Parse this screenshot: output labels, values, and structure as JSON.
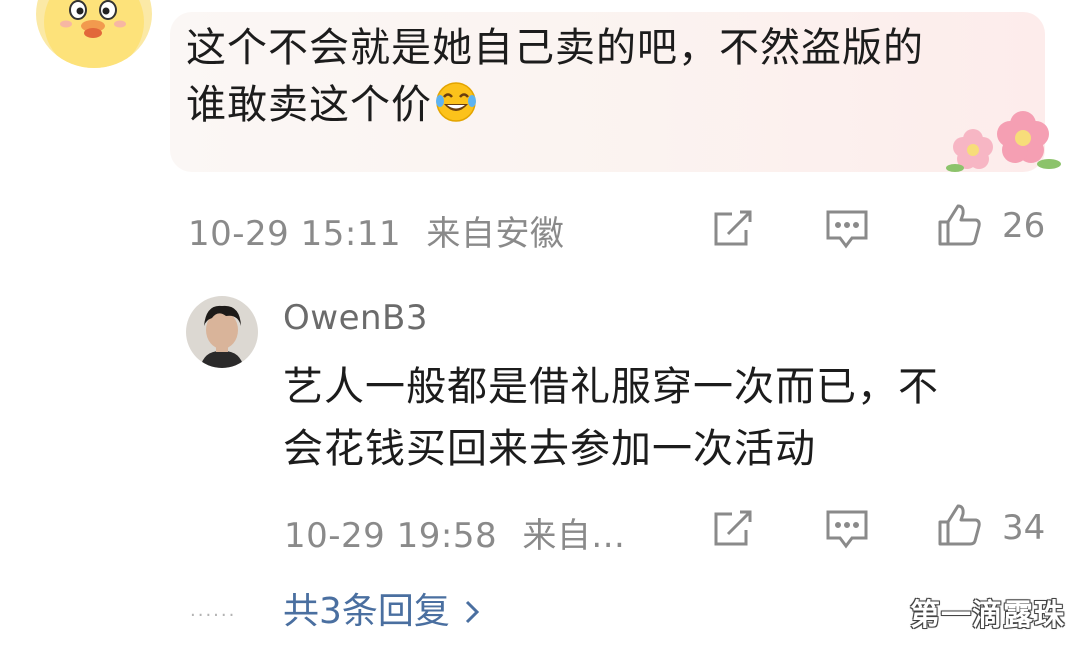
{
  "comment": {
    "text_line1": "这个不会就是她自己卖的吧，不然盗版的",
    "text_line2": "谁敢卖这个价",
    "emoji": "laughing-tears-emoji",
    "timestamp": "10-29 15:11",
    "location": "来自安徽",
    "like_count": "26"
  },
  "reply": {
    "username": "OwenB3",
    "text_line1": "艺人一般都是借礼服穿一次而已，不",
    "text_line2": "会花钱买回来去参加一次活动",
    "timestamp": "10-29 19:58",
    "location": "来自...",
    "like_count": "34"
  },
  "thread": {
    "more_replies_label": "共3条回复",
    "dots": "......"
  },
  "watermark": "第一滴露珠",
  "icons": [
    "share-icon",
    "comment-icon",
    "like-icon",
    "chevron-right-icon"
  ],
  "colors": {
    "meta": "#8a8a8a",
    "link": "#4a6fa0",
    "bubble": "#fbf3f0"
  }
}
